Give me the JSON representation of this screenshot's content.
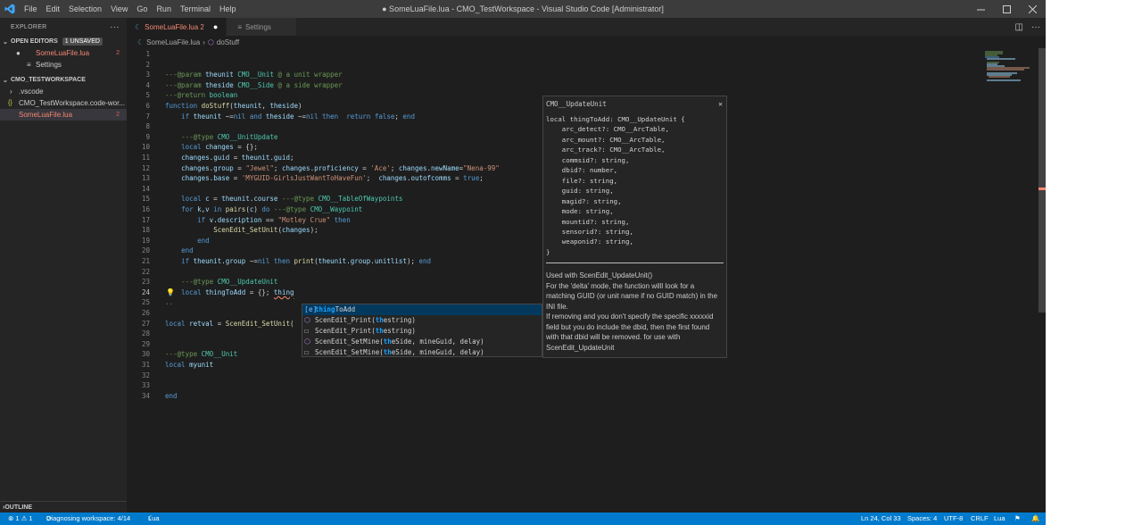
{
  "titlebar": {
    "menu": [
      "File",
      "Edit",
      "Selection",
      "View",
      "Go",
      "Run",
      "Terminal",
      "Help"
    ],
    "title": "● SomeLuaFile.lua - CMO_TestWorkspace - Visual Studio Code [Administrator]"
  },
  "sidebar": {
    "header": "EXPLORER",
    "open_editors": {
      "title": "OPEN EDITORS",
      "badge": "1 UNSAVED",
      "items": [
        {
          "label": "SomeLuaFile.lua",
          "count": "2"
        },
        {
          "label": "Settings"
        }
      ]
    },
    "workspace": {
      "title": "CMO_TESTWORKSPACE",
      "items": [
        {
          "label": ".vscode"
        },
        {
          "label": "CMO_TestWorkspace.code-wor..."
        },
        {
          "label": "SomeLuaFile.lua",
          "count": "2"
        }
      ]
    },
    "outline": "OUTLINE"
  },
  "tabs": [
    {
      "label": "SomeLuaFile.lua 2"
    },
    {
      "label": "Settings"
    }
  ],
  "breadcrumb": {
    "file": "SomeLuaFile.lua",
    "symbol": "doStuff"
  },
  "hover": {
    "title": "CMO__UpdateUnit",
    "code": "local thingToAdd: CMO__UpdateUnit {\n    arc_detect?: CMO__ArcTable,\n    arc_mount?: CMO__ArcTable,\n    arc_track?: CMO__ArcTable,\n    commsid?: string,\n    dbid?: number,\n    file?: string,\n    guid: string,\n    magid?: string,\n    mode: string,\n    mountid?: string,\n    sensorid?: string,\n    weaponid?: string,\n}",
    "doc": [
      "Used with ScenEdit_UpdateUnit()",
      "For the 'delta' mode, the function willl look for a matching GUID (or unit name if no GUID match) in the INI file.",
      "If removing and you don't specify the specific xxxxxid field but you do include the dbid, then the first found with that dbid will be removed. for use with ScenEdit_UpdateUnit"
    ]
  },
  "suggest": [
    {
      "pre": "",
      "m": "thing",
      "post": "ToAdd"
    },
    {
      "pre": "ScenEdit_Print(",
      "m": "th",
      "post": "estring)"
    },
    {
      "pre": "ScenEdit_Print(",
      "m": "th",
      "post": "estring)"
    },
    {
      "pre": "ScenEdit_SetMine(",
      "m": "th",
      "post": "eSide, mineGuid, delay)"
    },
    {
      "pre": "ScenEdit_SetMine(",
      "m": "th",
      "post": "eSide, mineGuid, delay)"
    }
  ],
  "status": {
    "problems": "⊗ 1 ⚠ 1",
    "diag": "Diagnosing workspace: 4/14",
    "lang_left": "Lua",
    "pos": "Ln 24, Col 33",
    "spaces": "Spaces: 4",
    "enc": "UTF-8",
    "eol": "CRLF",
    "lang": "Lua"
  },
  "colors": {
    "accent": "#007acc",
    "error": "#f48771",
    "bg": "#1e1e1e"
  }
}
